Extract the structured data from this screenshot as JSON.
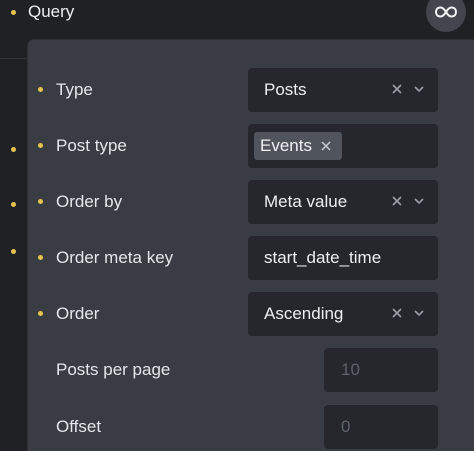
{
  "header": {
    "title": "Query"
  },
  "rows": {
    "type": {
      "label": "Type",
      "value": "Posts"
    },
    "post_type": {
      "label": "Post type",
      "tag": "Events"
    },
    "order_by": {
      "label": "Order by",
      "value": "Meta value"
    },
    "order_meta_key": {
      "label": "Order meta key",
      "value": "start_date_time"
    },
    "order": {
      "label": "Order",
      "value": "Ascending"
    },
    "posts_per_page": {
      "label": "Posts per page",
      "placeholder": "10"
    },
    "offset": {
      "label": "Offset",
      "placeholder": "0"
    }
  },
  "colors": {
    "accent_dot": "#e7c24e",
    "panel_bg": "#393c43",
    "control_bg": "#25272c",
    "page_bg": "#1f2125"
  },
  "icons": [
    "infinity-icon",
    "clear-icon",
    "chevron-down-icon"
  ]
}
